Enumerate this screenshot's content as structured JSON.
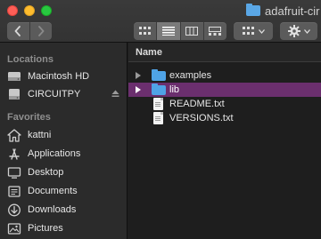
{
  "window": {
    "title": "adafruit-cir"
  },
  "toolbar": {
    "back_icon": "chevron-left-icon",
    "forward_icon": "chevron-right-icon",
    "views": [
      {
        "name": "icon-view",
        "active": false
      },
      {
        "name": "list-view",
        "active": true
      },
      {
        "name": "column-view",
        "active": false
      },
      {
        "name": "gallery-view",
        "active": false
      }
    ],
    "group_icon": "group-grid-icon",
    "action_icon": "gear-icon"
  },
  "sidebar": {
    "locations_header": "Locations",
    "locations": [
      {
        "label": "Macintosh HD",
        "icon": "hard-drive-icon"
      },
      {
        "label": "CIRCUITPY",
        "icon": "external-drive-icon",
        "ejectable": true
      }
    ],
    "favorites_header": "Favorites",
    "favorites": [
      {
        "label": "kattni",
        "icon": "home-icon"
      },
      {
        "label": "Applications",
        "icon": "applications-icon"
      },
      {
        "label": "Desktop",
        "icon": "desktop-icon"
      },
      {
        "label": "Documents",
        "icon": "documents-icon"
      },
      {
        "label": "Downloads",
        "icon": "downloads-icon"
      },
      {
        "label": "Pictures",
        "icon": "pictures-icon"
      }
    ]
  },
  "main": {
    "column_name": "Name",
    "rows": [
      {
        "label": "examples",
        "kind": "folder",
        "selected": false
      },
      {
        "label": "lib",
        "kind": "folder",
        "selected": true
      },
      {
        "label": "README.txt",
        "kind": "file",
        "selected": false
      },
      {
        "label": "VERSIONS.txt",
        "kind": "file",
        "selected": false
      }
    ]
  },
  "colors": {
    "selection": "#6b2f6e",
    "folder": "#4fa3e6",
    "sidebar_bg": "#2b2b2b",
    "main_bg": "#1e1e1e"
  }
}
